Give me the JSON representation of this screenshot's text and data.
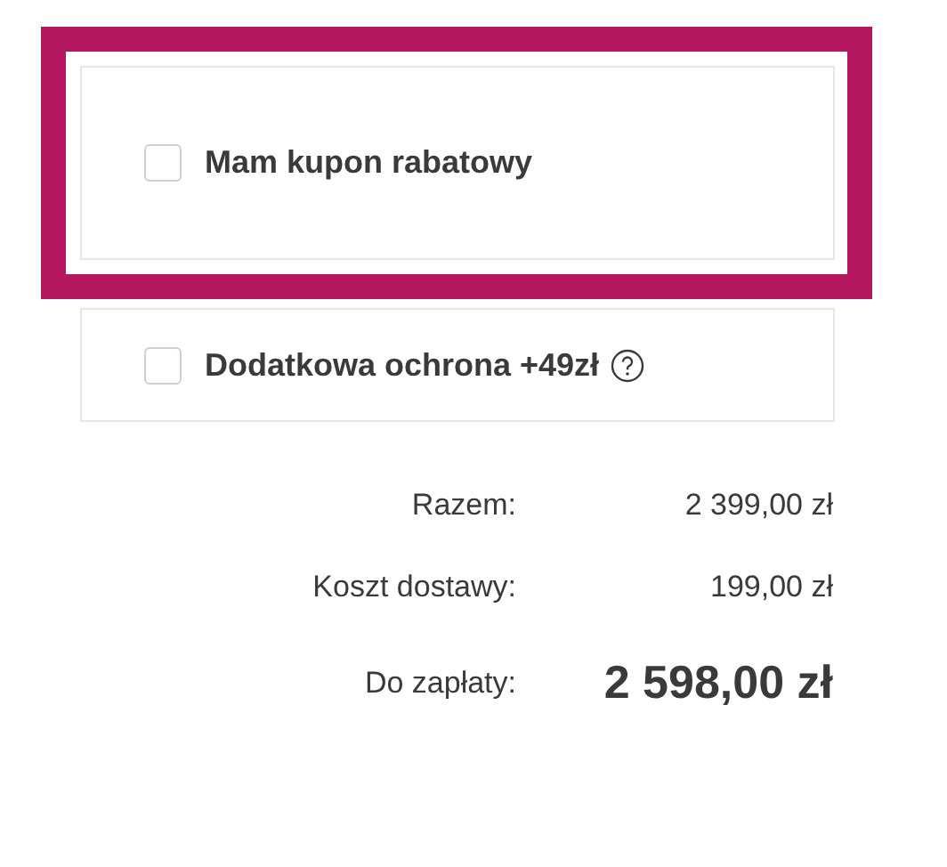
{
  "options": [
    {
      "label": "Mam kupon rabatowy",
      "checked": false,
      "highlighted": true,
      "help": false
    },
    {
      "label": "Dodatkowa ochrona +49zł",
      "checked": false,
      "highlighted": false,
      "help": true
    }
  ],
  "summary": [
    {
      "kind": "line",
      "label": "Razem:",
      "value": "2 399,00 zł"
    },
    {
      "kind": "line",
      "label": "Koszt dostawy:",
      "value": "199,00 zł"
    },
    {
      "kind": "total",
      "label": "Do zapłaty:",
      "value": "2 598,00 zł"
    }
  ]
}
